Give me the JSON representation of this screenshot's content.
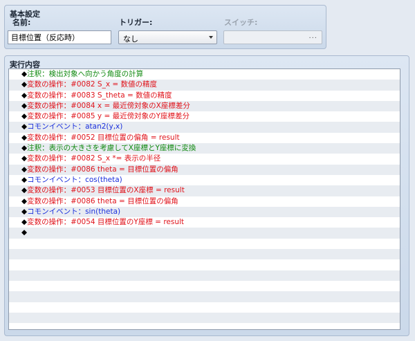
{
  "basic": {
    "title": "基本設定",
    "name_label": "名前:",
    "name_value": "目標位置（反応時）",
    "trigger_label": "トリガー:",
    "trigger_value": "なし",
    "switch_label": "スイッチ:",
    "switch_button": "..."
  },
  "content": {
    "title": "実行内容",
    "marker": "◆",
    "commands": [
      {
        "kind": "comment",
        "text": "注釈：検出対象へ向かう角度の計算"
      },
      {
        "kind": "var",
        "text": "変数の操作：#0082 S_x = 数値の精度"
      },
      {
        "kind": "var",
        "text": "変数の操作：#0083 S_theta = 数値の精度"
      },
      {
        "kind": "var",
        "text": "変数の操作：#0084 x = 最近傍対象のX座標差分"
      },
      {
        "kind": "var",
        "text": "変数の操作：#0085 y = 最近傍対象のY座標差分"
      },
      {
        "kind": "common",
        "text": "コモンイベント：atan2(y,x)"
      },
      {
        "kind": "var",
        "text": "変数の操作：#0052 目標位置の偏角 = result"
      },
      {
        "kind": "comment",
        "text": "注釈：表示の大きさを考慮してX座標とY座標に変換"
      },
      {
        "kind": "var",
        "text": "変数の操作：#0082 S_x *= 表示の半径"
      },
      {
        "kind": "var",
        "text": "変数の操作：#0086 theta = 目標位置の偏角"
      },
      {
        "kind": "common",
        "text": "コモンイベント：cos(theta)"
      },
      {
        "kind": "var",
        "text": "変数の操作：#0053 目標位置のX座標 = result"
      },
      {
        "kind": "var",
        "text": "変数の操作：#0086 theta = 目標位置の偏角"
      },
      {
        "kind": "common",
        "text": "コモンイベント：sin(theta)"
      },
      {
        "kind": "var",
        "text": "変数の操作：#0054 目標位置のY座標 = result"
      },
      {
        "kind": "plain",
        "text": ""
      }
    ],
    "empty_rows": 9
  }
}
